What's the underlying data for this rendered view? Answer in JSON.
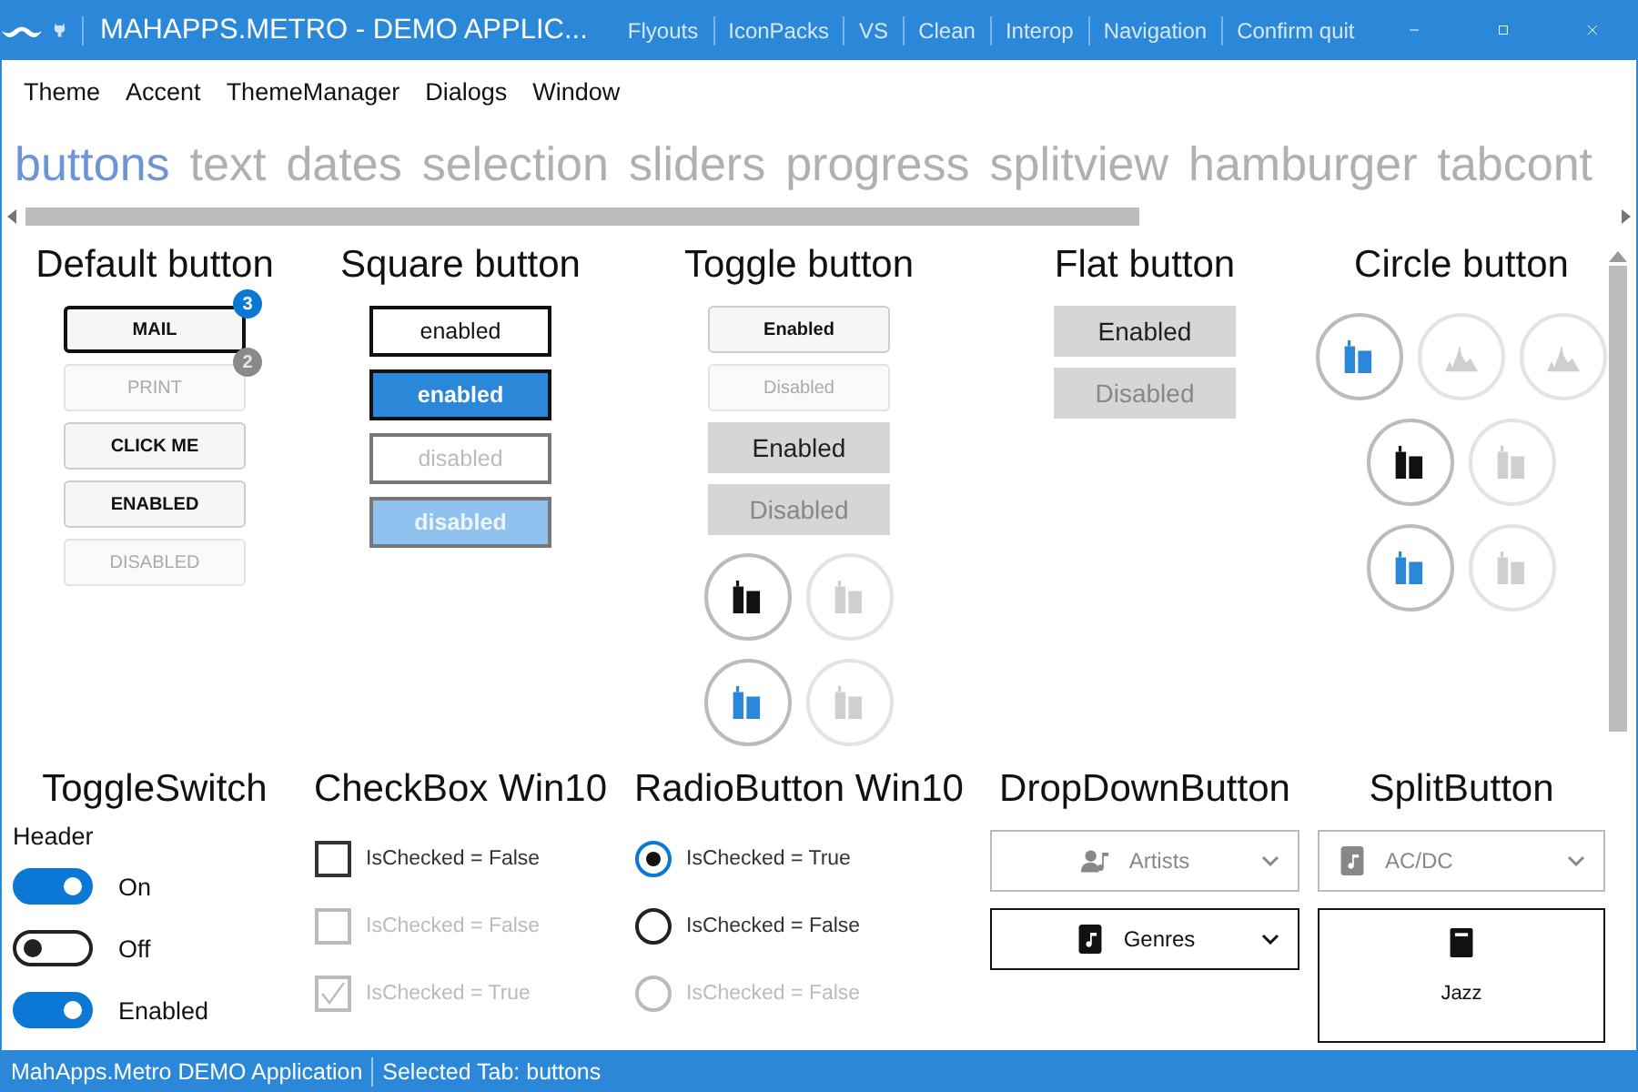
{
  "window": {
    "title": "MAHAPPS.METRO - DEMO APPLIC...",
    "commands": [
      "Flyouts",
      "IconPacks",
      "VS",
      "Clean",
      "Interop",
      "Navigation",
      "Confirm quit"
    ]
  },
  "menu": [
    "Theme",
    "Accent",
    "ThemeManager",
    "Dialogs",
    "Window"
  ],
  "tabs": [
    {
      "label": "buttons",
      "selected": true
    },
    {
      "label": "text",
      "selected": false
    },
    {
      "label": "dates",
      "selected": false
    },
    {
      "label": "selection",
      "selected": false
    },
    {
      "label": "sliders",
      "selected": false
    },
    {
      "label": "progress",
      "selected": false
    },
    {
      "label": "splitview",
      "selected": false
    },
    {
      "label": "hamburger",
      "selected": false
    },
    {
      "label": "tabcont",
      "selected": false
    }
  ],
  "default_button": {
    "title": "Default button",
    "buttons": [
      {
        "label": "MAIL",
        "disabled": false,
        "focused": true,
        "badge": "3"
      },
      {
        "label": "PRINT",
        "disabled": true,
        "focused": false,
        "badge": "2"
      },
      {
        "label": "CLICK ME",
        "disabled": false,
        "focused": false
      },
      {
        "label": "ENABLED",
        "disabled": false,
        "focused": false
      },
      {
        "label": "DISABLED",
        "disabled": true,
        "focused": false
      }
    ]
  },
  "square_button": {
    "title": "Square button",
    "buttons": [
      {
        "label": "enabled",
        "kind": "outline",
        "disabled": false
      },
      {
        "label": "enabled",
        "kind": "accent",
        "disabled": false
      },
      {
        "label": "disabled",
        "kind": "outline",
        "disabled": true
      },
      {
        "label": "disabled",
        "kind": "accent",
        "disabled": true
      }
    ]
  },
  "toggle_button": {
    "title": "Toggle button",
    "buttons": [
      {
        "kind": "default",
        "label": "Enabled",
        "disabled": false
      },
      {
        "kind": "default",
        "label": "Disabled",
        "disabled": true
      },
      {
        "kind": "flat",
        "label": "Enabled",
        "disabled": false
      },
      {
        "kind": "flat",
        "label": "Disabled",
        "disabled": true
      }
    ],
    "circles": [
      [
        {
          "kind": "buildings",
          "accent": false,
          "disabled": false
        },
        {
          "kind": "buildings",
          "accent": false,
          "disabled": true
        }
      ],
      [
        {
          "kind": "buildings",
          "accent": true,
          "disabled": false
        },
        {
          "kind": "buildings",
          "accent": false,
          "disabled": true
        }
      ]
    ]
  },
  "flat_button": {
    "title": "Flat button",
    "buttons": [
      {
        "label": "Enabled",
        "disabled": false
      },
      {
        "label": "Disabled",
        "disabled": true
      }
    ]
  },
  "circle_button": {
    "title": "Circle button",
    "rows": [
      [
        {
          "kind": "buildings",
          "accent": true,
          "disabled": false
        },
        {
          "kind": "skyline",
          "accent": false,
          "disabled": true
        },
        {
          "kind": "skyline",
          "accent": false,
          "disabled": true
        }
      ],
      [
        {
          "kind": "buildings",
          "accent": false,
          "disabled": false
        },
        {
          "kind": "buildings",
          "accent": false,
          "disabled": true
        }
      ],
      [
        {
          "kind": "buildings",
          "accent": true,
          "disabled": false
        },
        {
          "kind": "buildings",
          "accent": false,
          "disabled": true
        }
      ]
    ]
  },
  "toggle_switch": {
    "title": "ToggleSwitch",
    "header": "Header",
    "switches": [
      {
        "label": "On",
        "on": true
      },
      {
        "label": "Off",
        "on": false
      },
      {
        "label": "Enabled",
        "on": true
      }
    ]
  },
  "checkbox": {
    "title": "CheckBox Win10",
    "items": [
      {
        "label": "IsChecked = False",
        "checked": false,
        "disabled": false
      },
      {
        "label": "IsChecked = False",
        "checked": false,
        "disabled": true
      },
      {
        "label": "IsChecked = True",
        "checked": true,
        "disabled": true
      }
    ]
  },
  "radio": {
    "title": "RadioButton Win10",
    "items": [
      {
        "label": "IsChecked = True",
        "selected": true,
        "disabled": false
      },
      {
        "label": "IsChecked = False",
        "selected": false,
        "disabled": false
      },
      {
        "label": "IsChecked = False",
        "selected": false,
        "disabled": true
      }
    ]
  },
  "dropdown_button": {
    "title": "DropDownButton",
    "items": [
      {
        "label": "Artists",
        "kind": "artist",
        "disabled": true
      },
      {
        "label": "Genres",
        "kind": "album",
        "disabled": false
      }
    ]
  },
  "split_button": {
    "title": "SplitButton",
    "items": [
      {
        "label": "AC/DC",
        "kind": "inline",
        "disabled": true
      },
      {
        "label": "Jazz",
        "kind": "stacked",
        "disabled": false
      }
    ]
  },
  "status_bar": [
    "MahApps.Metro DEMO Application",
    "Selected Tab:  buttons"
  ]
}
